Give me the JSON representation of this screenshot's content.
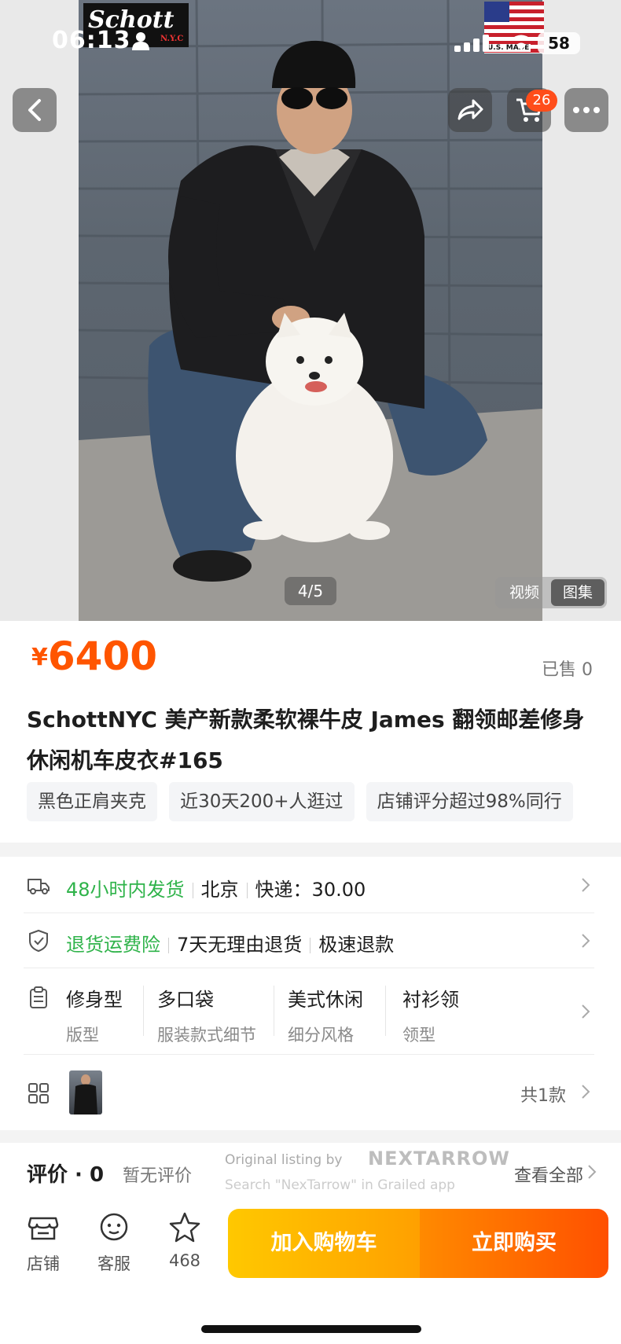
{
  "status_bar": {
    "time": "06:13",
    "battery": "58"
  },
  "header": {
    "cart_count": "26"
  },
  "gallery": {
    "brand_logo": "Schott",
    "brand_sub": "N.Y.C",
    "flag_caption": "U.S. MADE",
    "pager": "4/5",
    "tabs": [
      "视频",
      "图集"
    ],
    "active_tab": "图集"
  },
  "product": {
    "currency": "¥",
    "price": "6400",
    "sold": "已售 0",
    "title": "SchottNYC 美产新款柔软裸牛皮 James 翻领邮差修身休闲机车皮衣#165",
    "tags": [
      "黑色正肩夹克",
      "近30天200+人逛过",
      "店铺评分超过98%同行"
    ]
  },
  "shipping": {
    "highlight": "48小时内发货",
    "city": "北京",
    "fee": "快递：30.00"
  },
  "returns": {
    "highlight": "退货运费险",
    "policy1": "7天无理由退货",
    "policy2": "极速退款"
  },
  "attributes": [
    {
      "value": "修身型",
      "label": "版型"
    },
    {
      "value": "多口袋",
      "label": "服装款式细节"
    },
    {
      "value": "美式休闲",
      "label": "细分风格"
    },
    {
      "value": "衬衫领",
      "label": "领型"
    }
  ],
  "variants": {
    "total": "共1款"
  },
  "reviews": {
    "title": "评价 · 0",
    "none": "暂无评价",
    "see_all": "查看全部",
    "watermark_line1": "Original listing by",
    "watermark_logo": "NEXTARROW",
    "watermark_line2": "Search \"NexTarrow\" in Grailed app"
  },
  "bottom_bar": {
    "store": "店铺",
    "service": "客服",
    "favorites": "468",
    "add_to_cart": "加入购物车",
    "buy_now": "立即购买"
  },
  "colors": {
    "accent": "#ff5500",
    "green": "#2fb34a",
    "cart_btn": "#ffb300",
    "buy_btn": "#ff5a00"
  }
}
